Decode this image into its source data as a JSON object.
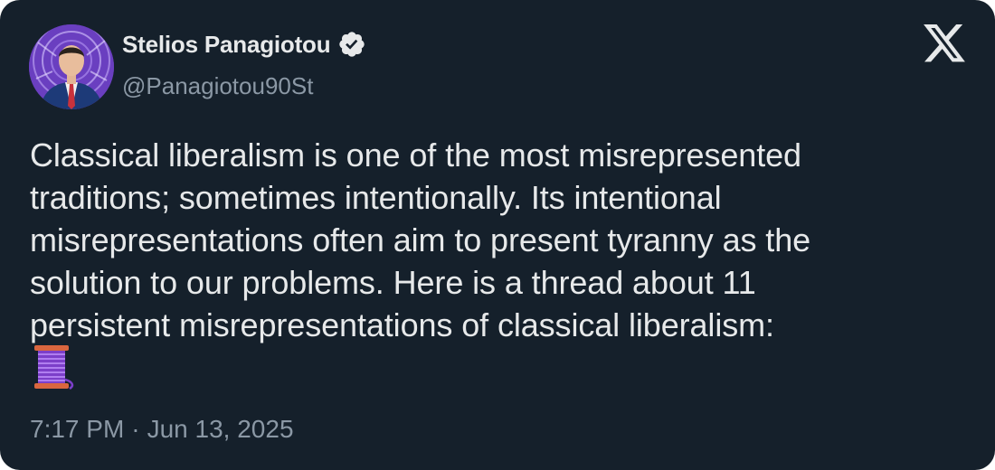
{
  "author": {
    "name": "Stelios Panagiotou",
    "handle": "@Panagiotou90St",
    "verified_icon": "verified-badge-icon",
    "avatar_icon": "profile-avatar"
  },
  "platform": {
    "logo_icon": "x-logo-icon"
  },
  "tweet": {
    "text": "Classical liberalism is one of the most misrepresented\ntraditions; sometimes intentionally. Its intentional\nmisrepresentations often aim to present tyranny as the\nsolution to our problems. Here is a thread about 11\npersistent misrepresentations of classical liberalism:",
    "emoji": "thread-spool-emoji",
    "time": "7:17 PM",
    "separator": "·",
    "date": "Jun 13, 2025"
  },
  "colors": {
    "background": "#15202b",
    "primary_text": "#e7e9ea",
    "secondary_text": "#8b98a5"
  }
}
